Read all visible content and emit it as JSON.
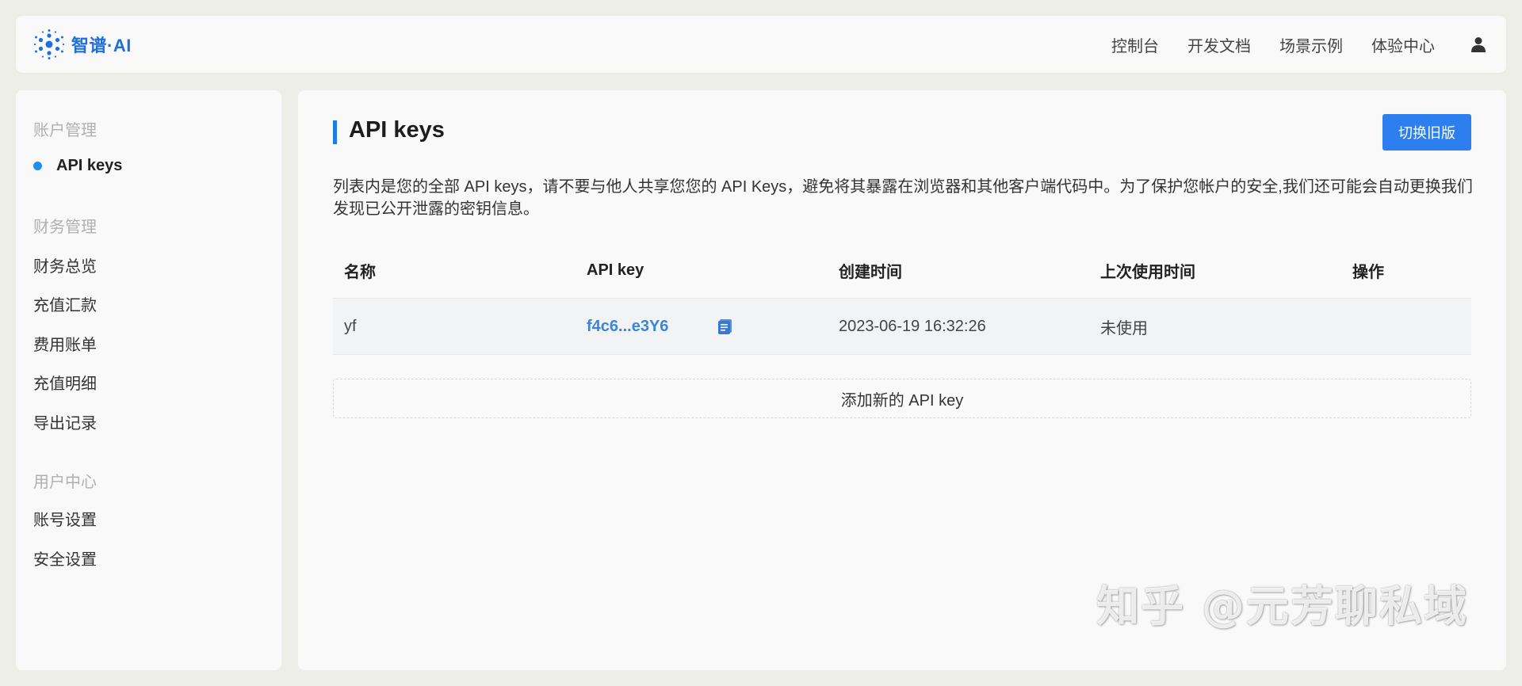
{
  "header": {
    "logo_text": "智谱·AI",
    "nav": [
      "控制台",
      "开发文档",
      "场景示例",
      "体验中心"
    ],
    "user_icon": "user-icon"
  },
  "sidebar": {
    "groups": [
      {
        "title": "账户管理",
        "items": [
          "API keys"
        ]
      },
      {
        "title": "财务管理",
        "items": [
          "财务总览",
          "充值汇款",
          "费用账单",
          "充值明细",
          "导出记录"
        ]
      },
      {
        "title": "用户中心",
        "items": [
          "账号设置",
          "安全设置"
        ]
      }
    ],
    "active_item": "API keys"
  },
  "main": {
    "title": "API keys",
    "switch_button": "切换旧版",
    "description": "列表内是您的全部 API keys，请不要与他人共享您您的 API Keys，避免将其暴露在浏览器和其他客户端代码中。为了保护您帐户的安全,我们还可能会自动更换我们发现已公开泄露的密钥信息。",
    "table": {
      "headers": [
        "名称",
        "API key",
        "创建时间",
        "上次使用时间",
        "操作"
      ],
      "rows": [
        {
          "name": "yf",
          "key": "f4c6...e3Y6",
          "created": "2023-06-19 16:32:26",
          "last_used": "未使用",
          "action": ""
        }
      ]
    },
    "add_button": "添加新的 API key"
  },
  "watermark": "知乎 @元芳聊私域",
  "colors": {
    "accent": "#2d7ff0",
    "link": "#3a86dc",
    "title_bar": "#1e7be8",
    "background": "#eeeee9",
    "panel": "#f9f9f9"
  }
}
